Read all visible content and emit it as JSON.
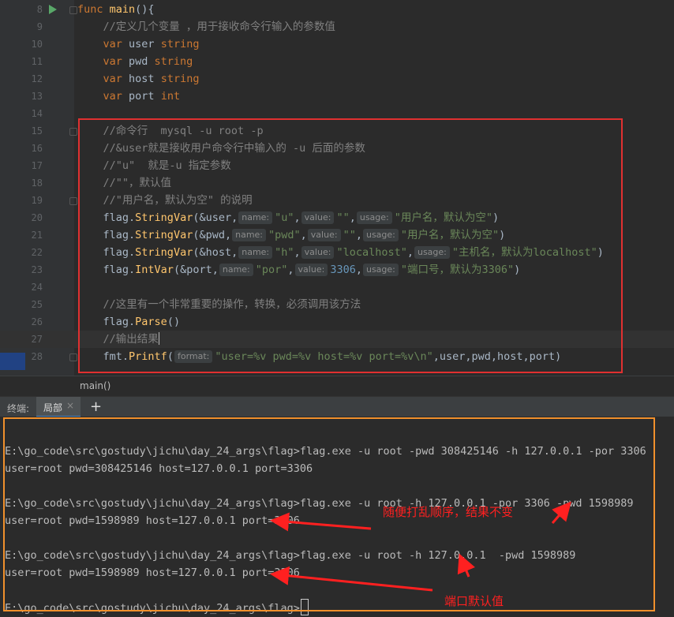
{
  "editor": {
    "lines": [
      {
        "num": "8",
        "code": "<span class=\"kw\">func</span> <span class=\"fn\">main</span>(){"
      },
      {
        "num": "9",
        "code": "    <span class=\"cm\">//定义几个变量 ，用于接收命令行输入的参数值</span>"
      },
      {
        "num": "10",
        "code": "    <span class=\"kw\">var</span> user <span class=\"kw\">string</span>"
      },
      {
        "num": "11",
        "code": "    <span class=\"kw\">var</span> pwd <span class=\"kw\">string</span>"
      },
      {
        "num": "12",
        "code": "    <span class=\"kw\">var</span> host <span class=\"kw\">string</span>"
      },
      {
        "num": "13",
        "code": "    <span class=\"kw\">var</span> port <span class=\"kw\">int</span>"
      },
      {
        "num": "14",
        "code": ""
      },
      {
        "num": "15",
        "code": "    <span class=\"cm\">//命令行  mysql -u root -p</span>"
      },
      {
        "num": "16",
        "code": "    <span class=\"cm\">//&amp;user就是接收用户命令行中输入的 -u 后面的参数</span>"
      },
      {
        "num": "17",
        "code": "    <span class=\"cm\">//\"u\"  就是-u 指定参数</span>"
      },
      {
        "num": "18",
        "code": "    <span class=\"cm\">//\"\"，默认值</span>"
      },
      {
        "num": "19",
        "code": "    <span class=\"cm\">//\"用户名，默认为空\" 的说明</span>"
      },
      {
        "num": "20",
        "code": "    <span class=\"pkg\">flag</span>.<span class=\"call\">StringVar</span>(&amp;user,<span class=\"hint\">name:</span><span class=\"str\">\"u\"</span>,<span class=\"hint\">value:</span><span class=\"str\">\"\"</span>,<span class=\"hint\">usage:</span><span class=\"str\">\"用户名，默认为空\"</span>)"
      },
      {
        "num": "21",
        "code": "    <span class=\"pkg\">flag</span>.<span class=\"call\">StringVar</span>(&amp;pwd,<span class=\"hint\">name:</span><span class=\"str\">\"pwd\"</span>,<span class=\"hint\">value:</span><span class=\"str\">\"\"</span>,<span class=\"hint\">usage:</span><span class=\"str\">\"用户名，默认为空\"</span>)"
      },
      {
        "num": "22",
        "code": "    <span class=\"pkg\">flag</span>.<span class=\"call\">StringVar</span>(&amp;host,<span class=\"hint\">name:</span><span class=\"str\">\"h\"</span>,<span class=\"hint\">value:</span><span class=\"str\">\"localhost\"</span>,<span class=\"hint\">usage:</span><span class=\"str\">\"主机名，默认为localhost\"</span>)"
      },
      {
        "num": "23",
        "code": "    <span class=\"pkg\">flag</span>.<span class=\"call\">IntVar</span>(&amp;port,<span class=\"hint\">name:</span><span class=\"str\">\"por\"</span>,<span class=\"hint\">value:</span><span class=\"num\">3306</span>,<span class=\"hint\">usage:</span><span class=\"str\">\"端口号，默认为3306\"</span>)"
      },
      {
        "num": "24",
        "code": ""
      },
      {
        "num": "25",
        "code": "    <span class=\"cm\">//这里有一个非常重要的操作，转换，必须调用该方法</span>"
      },
      {
        "num": "26",
        "code": "    <span class=\"pkg\">flag</span>.<span class=\"call\">Parse</span>()"
      },
      {
        "num": "27",
        "code": "    <span class=\"cm\">//输出结果</span><span class=\"cursor-bar\"></span>"
      },
      {
        "num": "28",
        "code": "    <span class=\"pkg\">fmt</span>.<span class=\"call\">Printf</span>(<span class=\"hint\">format:</span><span class=\"str\">\"user=%v pwd=%v host=%v port=%v\\n\"</span>,user,pwd,host,port)"
      }
    ],
    "current_line": "27",
    "breadcrumb": "main()"
  },
  "terminal": {
    "title": "终端:",
    "tab_label": "局部",
    "tab_close": "×",
    "add_label": "+",
    "lines": [
      "",
      "E:\\go_code\\src\\gostudy\\jichu\\day_24_args\\flag>flag.exe -u root -pwd 308425146 -h 127.0.0.1 -por 3306",
      "user=root pwd=308425146 host=127.0.0.1 port=3306",
      "",
      "E:\\go_code\\src\\gostudy\\jichu\\day_24_args\\flag>flag.exe -u root -h 127.0.0.1 -por 3306 -pwd 1598989",
      "user=root pwd=1598989 host=127.0.0.1 port=3306",
      "",
      "E:\\go_code\\src\\gostudy\\jichu\\day_24_args\\flag>flag.exe -u root -h 127.0.0.1  -pwd 1598989",
      "user=root pwd=1598989 host=127.0.0.1 port=3306",
      "",
      "E:\\go_code\\src\\gostudy\\jichu\\day_24_args\\flag>"
    ]
  },
  "annotations": {
    "shuffle_note": "随便打乱顺序，结果不变",
    "default_port_note": "端口默认值"
  },
  "colors": {
    "red_box": "#e03030",
    "orange_box": "#f0902c",
    "annotation_text": "#ff2020",
    "run_icon": "#59a869"
  }
}
